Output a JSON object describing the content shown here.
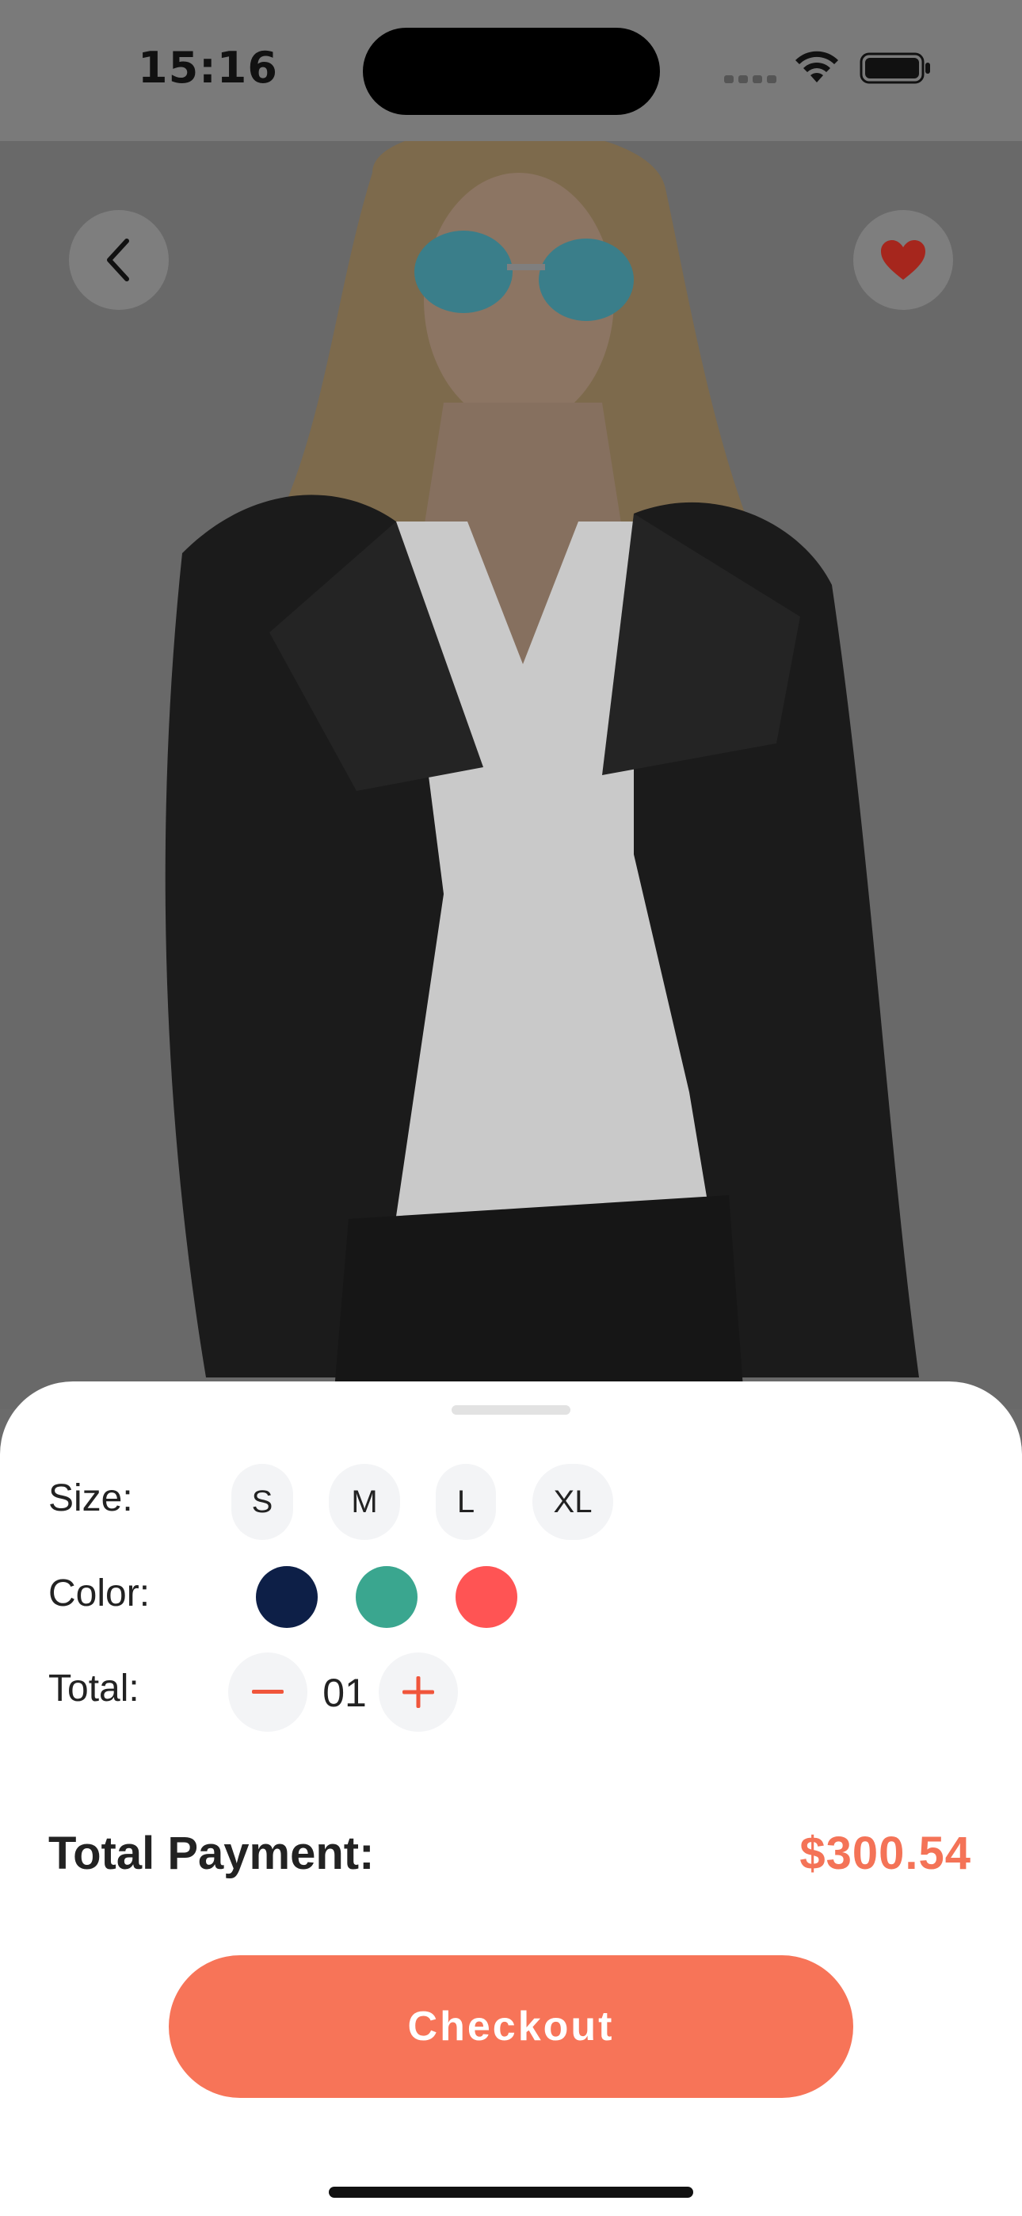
{
  "status_bar": {
    "time": "15:16"
  },
  "navigation": {
    "back_icon": "chevron-left-icon",
    "favorite_icon": "heart-icon",
    "favorite_color": "#b3261e"
  },
  "product": {
    "image_description_icon": "product-photo"
  },
  "options": {
    "size_label": "Size:",
    "sizes": [
      "S",
      "M",
      "L",
      "XL"
    ],
    "color_label": "Color:",
    "colors": [
      "#0d1f47",
      "#3aa68f",
      "#ff5454"
    ],
    "total_label": "Total:",
    "quantity": "01"
  },
  "payment": {
    "label": "Total Payment:",
    "value": "$300.54",
    "accent": "#f47357"
  },
  "checkout_label": "Checkout"
}
